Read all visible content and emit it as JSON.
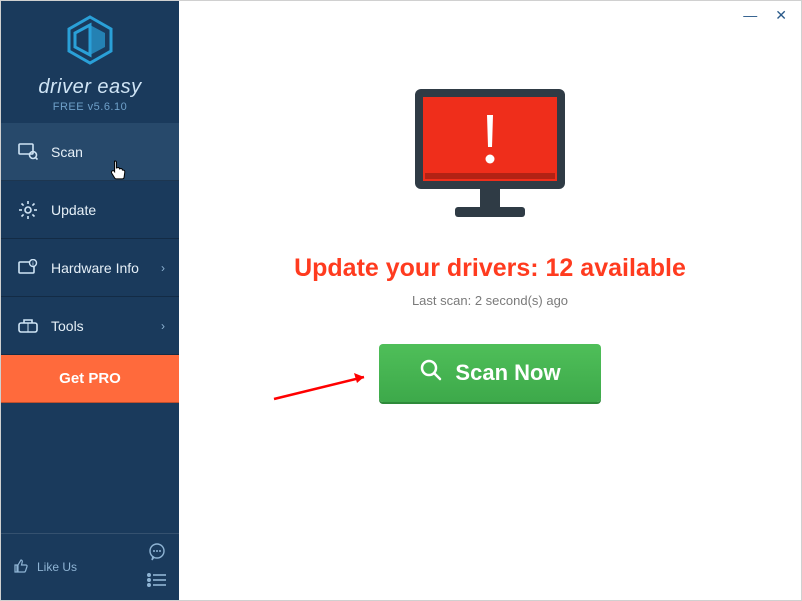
{
  "brand": {
    "name": "driver easy",
    "version": "FREE v5.6.10"
  },
  "sidebar": {
    "items": [
      {
        "label": "Scan",
        "has_chevron": false
      },
      {
        "label": "Update",
        "has_chevron": false
      },
      {
        "label": "Hardware Info",
        "has_chevron": true
      },
      {
        "label": "Tools",
        "has_chevron": true
      }
    ],
    "get_pro": "Get PRO",
    "like_us": "Like Us"
  },
  "main": {
    "headline": "Update your drivers: 12 available",
    "last_scan": "Last scan: 2 second(s) ago",
    "scan_button": "Scan Now"
  }
}
